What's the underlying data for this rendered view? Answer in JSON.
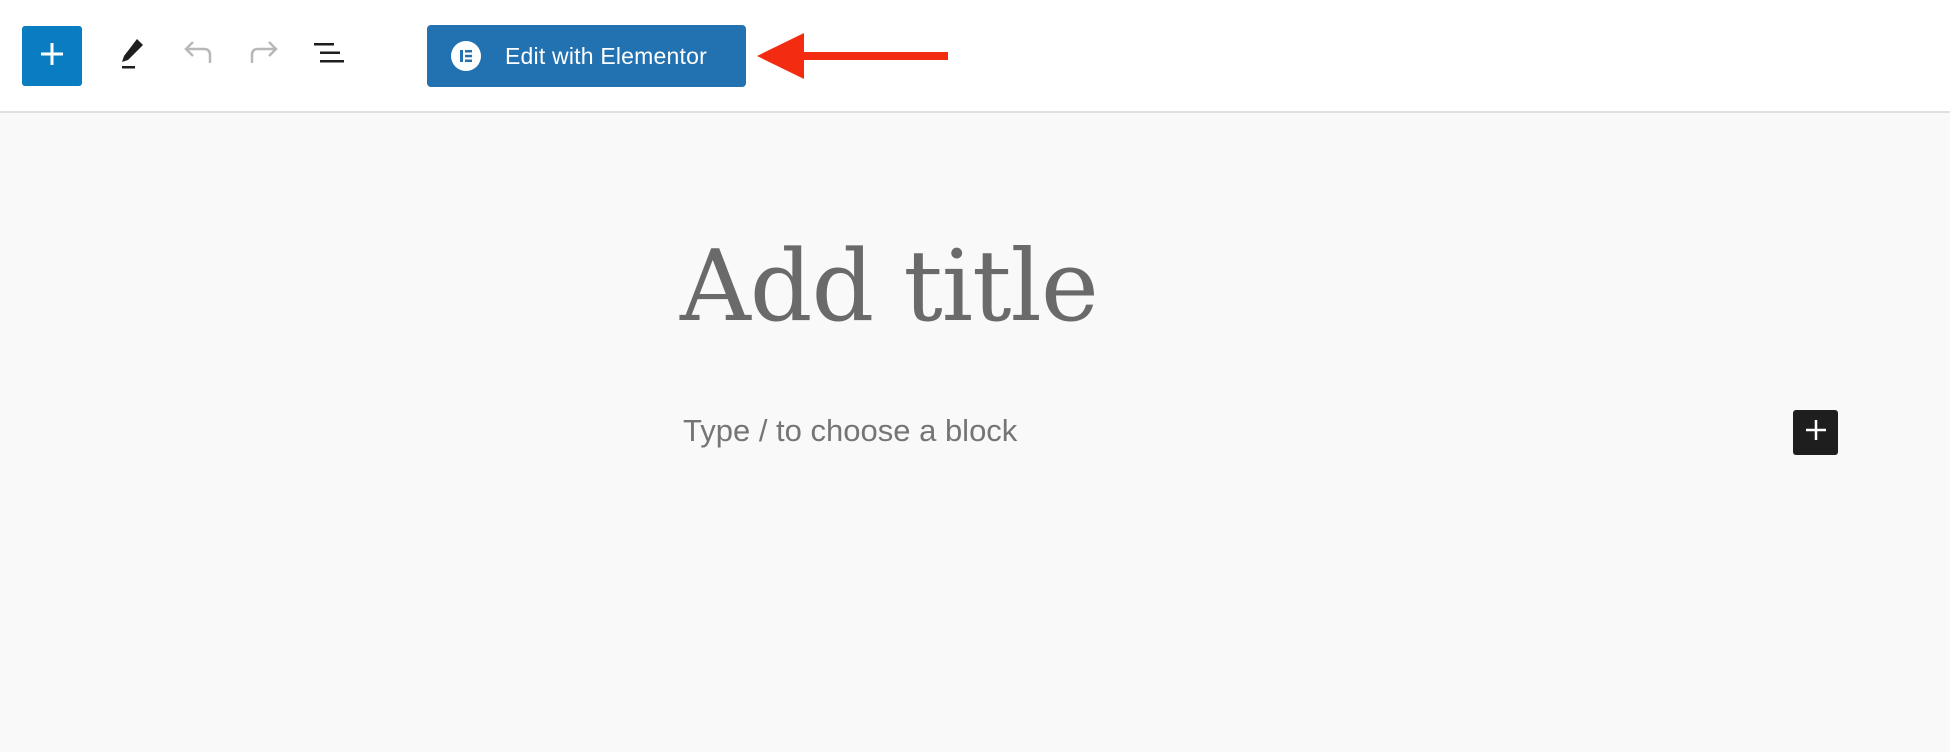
{
  "toolbar": {
    "inserter_icon": "plus-icon",
    "tools_icon": "pencil-icon",
    "undo_icon": "undo-icon",
    "redo_icon": "redo-icon",
    "document_overview_icon": "list-view-icon",
    "elementor_button": {
      "label": "Edit with Elementor",
      "icon": "elementor-logo-icon",
      "color": "#2271b1"
    },
    "accent_color": "#0a7cc1"
  },
  "annotation": {
    "icon": "arrow-left-icon",
    "color": "#f32b10"
  },
  "editor": {
    "title_placeholder": "Add title",
    "block_placeholder": "Type / to choose a block",
    "block_inserter_icon": "plus-icon"
  }
}
